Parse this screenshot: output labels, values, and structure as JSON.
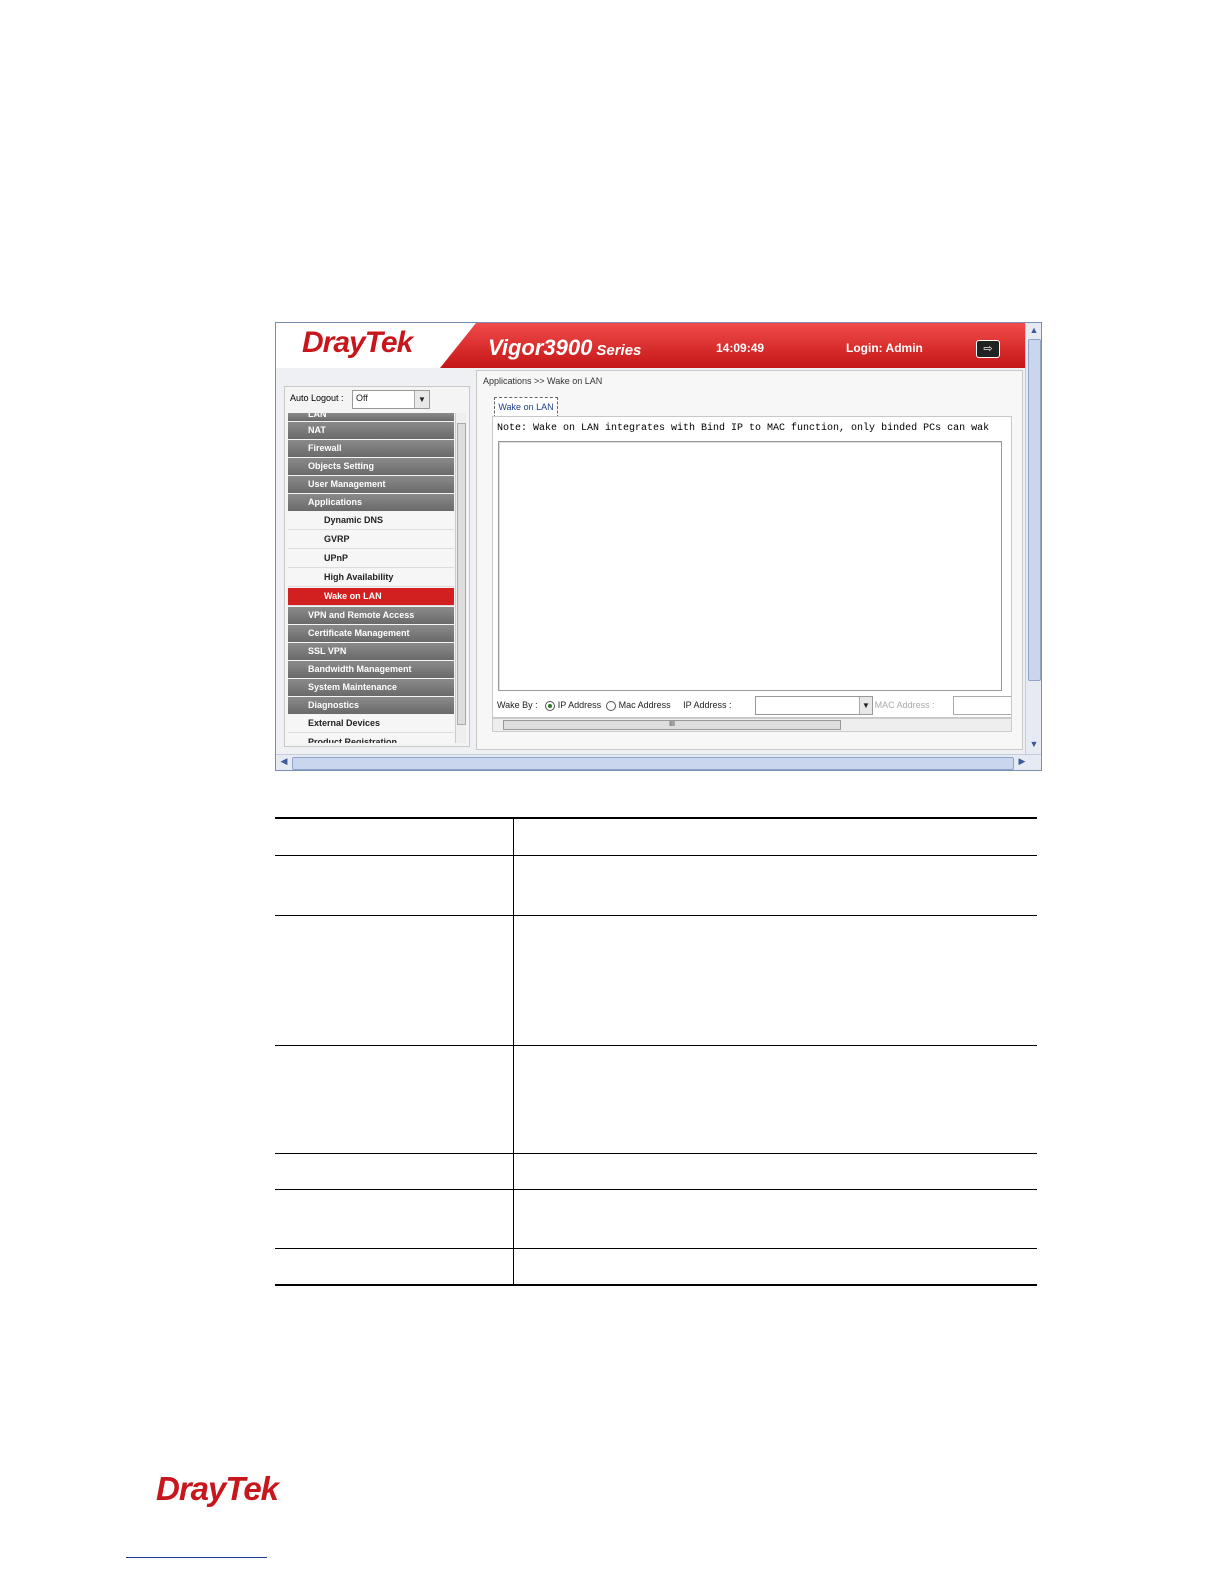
{
  "header": {
    "brand": "DrayTek",
    "model": "Vigor3900",
    "series": "Series",
    "time": "14:09:49",
    "login": "Login: Admin",
    "logout_icon": "logout-icon"
  },
  "sidebar": {
    "auto_logout_label": "Auto Logout :",
    "auto_logout_value": "Off",
    "items": [
      {
        "label": "LAN",
        "type": "cut"
      },
      {
        "label": "NAT",
        "type": "main"
      },
      {
        "label": "Firewall",
        "type": "main"
      },
      {
        "label": "Objects Setting",
        "type": "main"
      },
      {
        "label": "User Management",
        "type": "main"
      },
      {
        "label": "Applications",
        "type": "main"
      },
      {
        "label": "Dynamic DNS",
        "type": "sub"
      },
      {
        "label": "GVRP",
        "type": "sub"
      },
      {
        "label": "UPnP",
        "type": "sub"
      },
      {
        "label": "High Availability",
        "type": "sub"
      },
      {
        "label": "Wake on LAN",
        "type": "active"
      },
      {
        "label": "VPN and Remote Access",
        "type": "main"
      },
      {
        "label": "Certificate Management",
        "type": "main"
      },
      {
        "label": "SSL VPN",
        "type": "main"
      },
      {
        "label": "Bandwidth Management",
        "type": "main"
      },
      {
        "label": "System Maintenance",
        "type": "main"
      },
      {
        "label": "Diagnostics",
        "type": "main"
      },
      {
        "label": "External Devices",
        "type": "light"
      },
      {
        "label": "Product Registration",
        "type": "light"
      }
    ]
  },
  "content": {
    "breadcrumb": "Applications >> Wake on LAN",
    "tab": "Wake on LAN",
    "note": "Note: Wake on LAN integrates with Bind IP to MAC function, only binded PCs can wak",
    "wake_by_label": "Wake By :",
    "option_ip": "IP Address",
    "option_mac": "Mac Address",
    "ip_address_label": "IP Address :",
    "mac_address_label": "MAC Address :",
    "hscroll_marker": "III"
  },
  "footer": {
    "brand": "DrayTek"
  }
}
